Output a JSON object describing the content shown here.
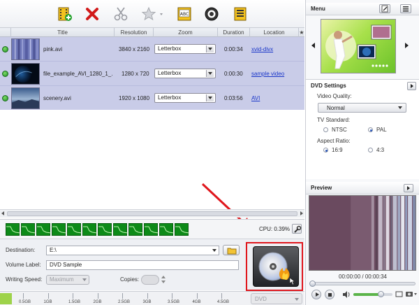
{
  "colors": {
    "row_background": "#c9cce8",
    "link": "#1a36c9",
    "highlight_border": "#e0161c",
    "cpu_green": "#0d8a18",
    "capacity_fill": "#9ed34a"
  },
  "toolbar": {
    "icons": [
      "add-video-icon",
      "remove-icon",
      "trim-icon",
      "effects-star-icon",
      "subtitles-icon",
      "dvd-disc-icon",
      "menu-list-icon"
    ]
  },
  "table": {
    "columns": [
      "Title",
      "Resolution",
      "Zoom",
      "Duration",
      "Location"
    ],
    "rows": [
      {
        "title": "pink.avi",
        "resolution": "3840 x 2160",
        "zoom": "Letterbox",
        "duration": "0:00:34",
        "location": "xvid-divx"
      },
      {
        "title": "file_example_AVI_1280_1_...",
        "resolution": "1280 x 720",
        "zoom": "Letterbox",
        "duration": "0:00:30",
        "location": "sample video"
      },
      {
        "title": "scenery.avi",
        "resolution": "1920 x 1080",
        "zoom": "Letterbox",
        "duration": "0:03:56",
        "location": "AVI"
      }
    ]
  },
  "cpu": {
    "label": "CPU: 0.39%",
    "cells": 12
  },
  "form": {
    "destination_label": "Destination:",
    "destination_value": "E:\\",
    "volume_label": "Volume Label:",
    "volume_value": "DVD Sample",
    "speed_label": "Writing Speed:",
    "speed_value": "Maximum",
    "copies_label": "Copies:",
    "disc_type": "DVD"
  },
  "capacity": {
    "ticks": [
      "0.5GB",
      "1GB",
      "1.5GB",
      "2GB",
      "2.5GB",
      "3GB",
      "3.5GB",
      "4GB",
      "4.5GB"
    ],
    "used_fraction": 0.04
  },
  "right": {
    "menu_title": "Menu",
    "dvd_settings_title": "DVD Settings",
    "video_quality_label": "Video Quality:",
    "video_quality_value": "Normal",
    "tv_standard_label": "TV Standard:",
    "tv_options": [
      "NTSC",
      "PAL"
    ],
    "tv_selected": "PAL",
    "aspect_label": "Aspect Ratio:",
    "aspect_options": [
      "16:9",
      "4:3"
    ],
    "aspect_selected": "16:9",
    "preview_title": "Preview",
    "time": "00:00:00 / 00:00:34",
    "volume_fraction": 0.7
  }
}
